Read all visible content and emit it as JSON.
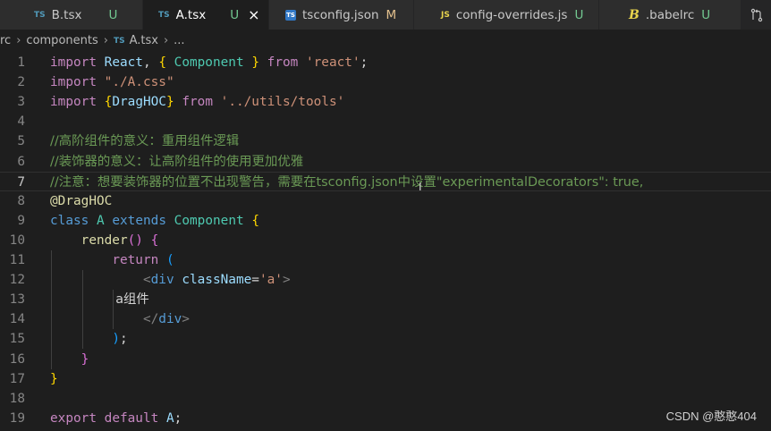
{
  "tabs": [
    {
      "icon": "TS",
      "label": "B.tsx",
      "status": "U",
      "active": false
    },
    {
      "icon": "TS",
      "label": "A.tsx",
      "status": "U",
      "active": true
    },
    {
      "icon": "TS",
      "label": "tsconfig.json",
      "status": "M",
      "active": false
    },
    {
      "icon": "JS",
      "label": "config-overrides.js",
      "status": "U",
      "active": false
    },
    {
      "icon": "B",
      "label": ".babelrc",
      "status": "U",
      "active": false
    }
  ],
  "close_glyph": "×",
  "breadcrumb": {
    "part1": "rc",
    "part2": "components",
    "icon": "TS",
    "file": "A.tsx",
    "rest": "..."
  },
  "lines": [
    {
      "n": "1",
      "t": [
        [
          "kw2",
          "import"
        ],
        [
          "plain",
          " "
        ],
        [
          "var",
          "React"
        ],
        [
          "plain",
          ", "
        ],
        [
          "b1",
          "{"
        ],
        [
          "plain",
          " "
        ],
        [
          "cls",
          "Component"
        ],
        [
          "plain",
          " "
        ],
        [
          "b1",
          "}"
        ],
        [
          "plain",
          " "
        ],
        [
          "kw2",
          "from"
        ],
        [
          "plain",
          " "
        ],
        [
          "str",
          "'react'"
        ],
        [
          "plain",
          ";"
        ]
      ]
    },
    {
      "n": "2",
      "t": [
        [
          "kw2",
          "import"
        ],
        [
          "plain",
          " "
        ],
        [
          "str",
          "\"./A.css\""
        ]
      ]
    },
    {
      "n": "3",
      "t": [
        [
          "kw2",
          "import"
        ],
        [
          "plain",
          " "
        ],
        [
          "b1",
          "{"
        ],
        [
          "var",
          "DragHOC"
        ],
        [
          "b1",
          "}"
        ],
        [
          "plain",
          " "
        ],
        [
          "kw2",
          "from"
        ],
        [
          "plain",
          " "
        ],
        [
          "str",
          "'../utils/tools'"
        ]
      ]
    },
    {
      "n": "4",
      "t": []
    },
    {
      "n": "5",
      "t": [
        [
          "com",
          "//高阶组件的意义：重用组件逻辑"
        ]
      ]
    },
    {
      "n": "6",
      "t": [
        [
          "com",
          "//装饰器的意义：让高阶组件的使用更加优雅"
        ]
      ]
    },
    {
      "n": "7",
      "t": [
        [
          "com",
          "//注意：想要装饰器的位置不出现警告，需要在tsconfig.json中设置\"experimentalDecorators\": true,"
        ]
      ]
    },
    {
      "n": "8",
      "t": [
        [
          "fn",
          "@DragHOC"
        ]
      ]
    },
    {
      "n": "9",
      "t": [
        [
          "kw",
          "class"
        ],
        [
          "plain",
          " "
        ],
        [
          "cls",
          "A"
        ],
        [
          "plain",
          " "
        ],
        [
          "kw",
          "extends"
        ],
        [
          "plain",
          " "
        ],
        [
          "cls",
          "Component"
        ],
        [
          "plain",
          " "
        ],
        [
          "b1",
          "{"
        ]
      ]
    },
    {
      "n": "10",
      "t": [
        [
          "plain",
          "    "
        ],
        [
          "fn",
          "render"
        ],
        [
          "b2",
          "()"
        ],
        [
          "plain",
          " "
        ],
        [
          "b2",
          "{"
        ]
      ]
    },
    {
      "n": "11",
      "t": [
        [
          "plain",
          "        "
        ],
        [
          "kw2",
          "return"
        ],
        [
          "plain",
          " "
        ],
        [
          "b3",
          "("
        ]
      ]
    },
    {
      "n": "12",
      "t": [
        [
          "plain",
          "            "
        ],
        [
          "tagb",
          "<"
        ],
        [
          "kw",
          "div"
        ],
        [
          "plain",
          " "
        ],
        [
          "attr",
          "className"
        ],
        [
          "plain",
          "="
        ],
        [
          "str",
          "'a'"
        ],
        [
          "tagb",
          ">"
        ]
      ]
    },
    {
      "n": "13",
      "t": [
        [
          "plain",
          "                a组件"
        ]
      ]
    },
    {
      "n": "14",
      "t": [
        [
          "plain",
          "            "
        ],
        [
          "tagb",
          "</"
        ],
        [
          "kw",
          "div"
        ],
        [
          "tagb",
          ">"
        ]
      ]
    },
    {
      "n": "15",
      "t": [
        [
          "plain",
          "        "
        ],
        [
          "b3",
          ")"
        ],
        [
          "plain",
          ";"
        ]
      ]
    },
    {
      "n": "16",
      "t": [
        [
          "plain",
          "    "
        ],
        [
          "b2",
          "}"
        ]
      ]
    },
    {
      "n": "17",
      "t": [
        [
          "b1",
          "}"
        ]
      ]
    },
    {
      "n": "18",
      "t": []
    },
    {
      "n": "19",
      "t": [
        [
          "kw2",
          "export"
        ],
        [
          "plain",
          " "
        ],
        [
          "kw2",
          "default"
        ],
        [
          "plain",
          " "
        ],
        [
          "var",
          "A"
        ],
        [
          "plain",
          ";"
        ]
      ]
    }
  ],
  "current_line": 7,
  "watermark": "CSDN @憨憨404"
}
